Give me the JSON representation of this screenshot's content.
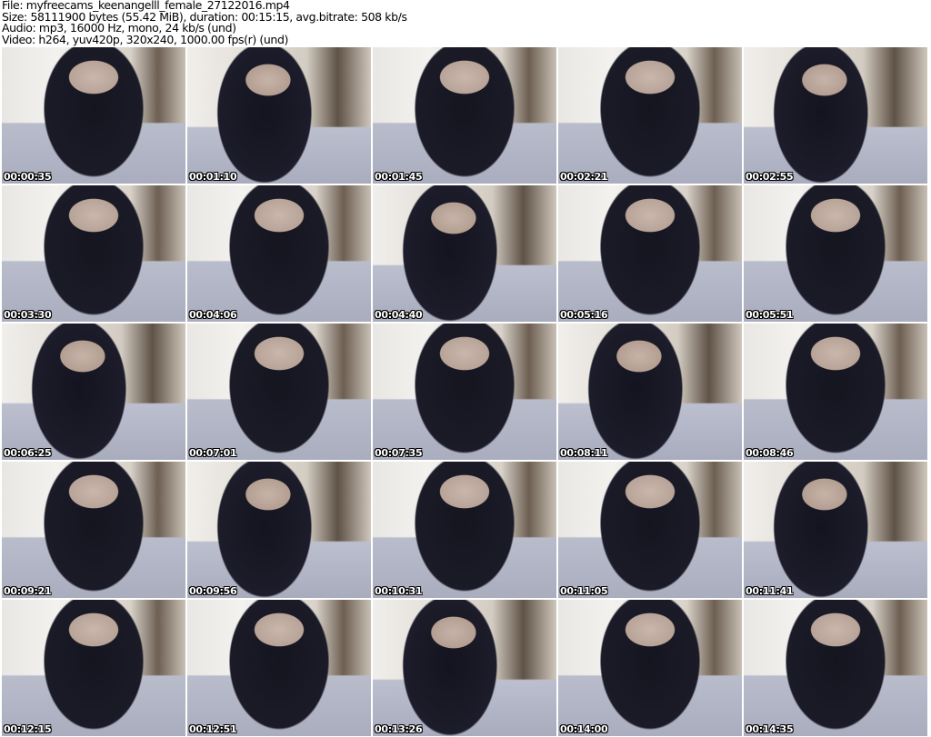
{
  "header": {
    "file": "File: myfreecams_keenangelll_female_27122016.mp4",
    "size": "Size: 58111900 bytes (55.42 MiB), duration: 00:15:15, avg.bitrate: 508 kb/s",
    "audio": "Audio: mp3, 16000 Hz, mono, 24 kb/s (und)",
    "video": "Video: h264, yuv420p, 320x240, 1000.00 fps(r) (und)"
  },
  "thumbnails": [
    "00:00:35",
    "00:01:10",
    "00:01:45",
    "00:02:21",
    "00:02:55",
    "00:03:30",
    "00:04:06",
    "00:04:40",
    "00:05:16",
    "00:05:51",
    "00:06:25",
    "00:07:01",
    "00:07:35",
    "00:08:11",
    "00:08:46",
    "00:09:21",
    "00:09:56",
    "00:10:31",
    "00:11:05",
    "00:11:41",
    "00:12:15",
    "00:12:51",
    "00:13:26",
    "00:14:00",
    "00:14:35"
  ]
}
